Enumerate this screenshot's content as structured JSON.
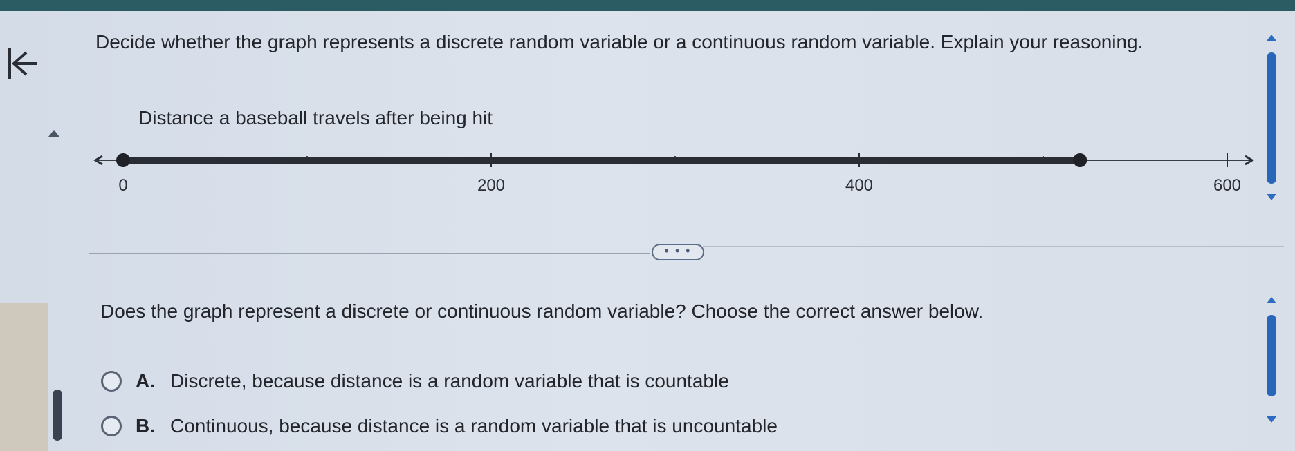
{
  "question": {
    "text": "Decide whether the graph represents a discrete random variable or a continuous random variable. Explain your reasoning."
  },
  "chart": {
    "title": "Distance a baseball travels after being hit",
    "tick_labels": [
      "0",
      "200",
      "400",
      "600"
    ]
  },
  "chart_data": {
    "type": "number line",
    "title": "Distance a baseball travels after being hit",
    "xlim": [
      0,
      600
    ],
    "ticks": [
      0,
      200,
      400,
      600
    ],
    "segment": {
      "start": 0,
      "end": 520,
      "start_closed": true,
      "end_closed": true
    }
  },
  "divider": {
    "more_label": "• • •"
  },
  "prompt": {
    "text": "Does the graph represent a discrete or continuous random variable? Choose the correct answer below."
  },
  "options": [
    {
      "letter": "A.",
      "text": "Discrete, because distance is a random variable that is countable"
    },
    {
      "letter": "B.",
      "text": "Continuous, because distance is a random variable that is uncountable"
    }
  ],
  "icons": {
    "back": "first-page-arrow-icon",
    "radio": "radio-unselected-icon"
  },
  "colors": {
    "header": "#2c5c63",
    "scroll_accent": "#2766b8",
    "line": "#2a2d33"
  }
}
